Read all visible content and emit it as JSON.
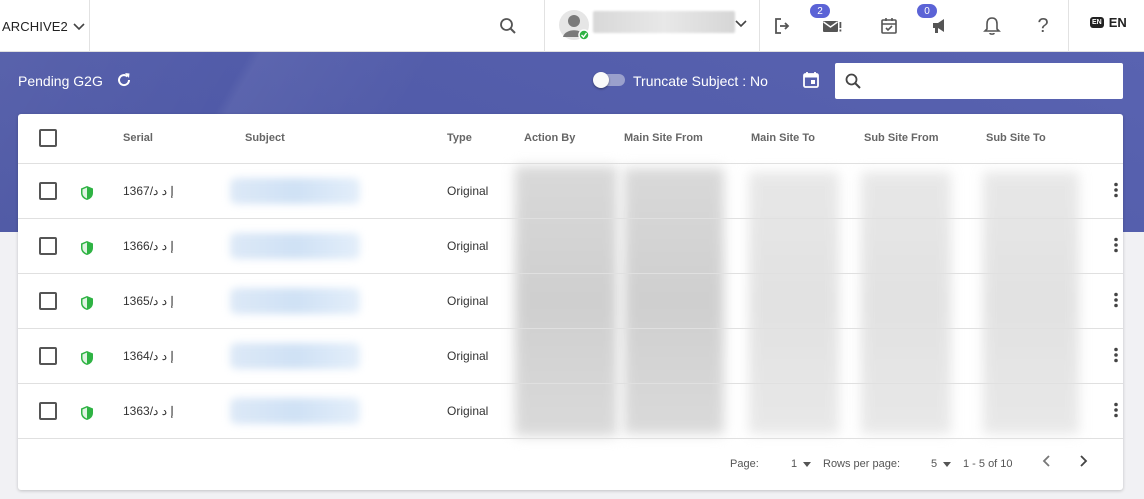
{
  "topbar": {
    "org_label": "ARCHIVE2",
    "inbox_badge": "2",
    "broadcast_badge": "0",
    "lang_chip": "EN",
    "lang_label": "EN"
  },
  "banner": {
    "title": "Pending G2G",
    "truncate_label": "Truncate Subject : No",
    "search_placeholder": ""
  },
  "table": {
    "columns": [
      "Serial",
      "Subject",
      "Type",
      "Action By",
      "Main Site From",
      "Main Site To",
      "Sub Site From",
      "Sub Site To"
    ],
    "rows": [
      {
        "serial": "1367/إ د د",
        "type": "Original"
      },
      {
        "serial": "1366/إ د د",
        "type": "Original"
      },
      {
        "serial": "1365/إ د د",
        "type": "Original"
      },
      {
        "serial": "1364/إ د د",
        "type": "Original"
      },
      {
        "serial": "1363/إ د د",
        "type": "Original"
      }
    ]
  },
  "footer": {
    "page_label": "Page:",
    "page_value": "1",
    "rows_per_page_label": "Rows per page:",
    "rows_per_page_value": "5",
    "range": "1 - 5 of 10"
  },
  "colors": {
    "banner": "#4f5aa8",
    "badge": "#5b63d6",
    "shield": "#2fb344"
  }
}
